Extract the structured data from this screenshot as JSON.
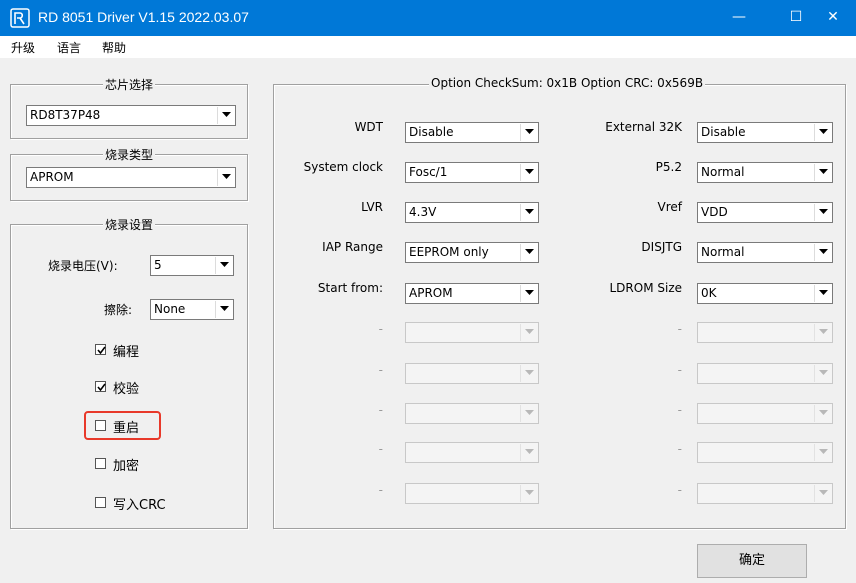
{
  "window": {
    "title": "RD 8051 Driver V1.15 2022.03.07",
    "minimize_glyph": "—",
    "maximize_glyph": "☐",
    "close_glyph": "✕"
  },
  "menu": [
    "升级",
    "语言",
    "帮助"
  ],
  "chip_select": {
    "legend": "芯片选择",
    "value": "RD8T37P48"
  },
  "burn_type": {
    "legend": "烧录类型",
    "value": "APROM"
  },
  "burn_settings": {
    "legend": "烧录设置",
    "voltage_label": "烧录电压(V):",
    "voltage_value": "5",
    "erase_label": "擦除:",
    "erase_value": "None",
    "checkboxes": [
      {
        "label": "编程",
        "checked": true
      },
      {
        "label": "校验",
        "checked": true
      },
      {
        "label": "重启",
        "checked": false
      },
      {
        "label": "加密",
        "checked": false
      },
      {
        "label": "写入CRC",
        "checked": false
      }
    ]
  },
  "options": {
    "legend": "Option CheckSum: 0x1B  Option CRC: 0x569B",
    "left": [
      {
        "label": "WDT",
        "value": "Disable"
      },
      {
        "label": "System clock",
        "value": "Fosc/1"
      },
      {
        "label": "LVR",
        "value": "4.3V"
      },
      {
        "label": "IAP Range",
        "value": "EEPROM only"
      },
      {
        "label": "Start from:",
        "value": "APROM"
      },
      {
        "label": "-",
        "value": ""
      },
      {
        "label": "-",
        "value": ""
      },
      {
        "label": "-",
        "value": ""
      },
      {
        "label": "-",
        "value": ""
      },
      {
        "label": "-",
        "value": ""
      }
    ],
    "right": [
      {
        "label": "External 32K",
        "value": "Disable"
      },
      {
        "label": "P5.2",
        "value": "Normal"
      },
      {
        "label": "Vref",
        "value": "VDD"
      },
      {
        "label": "DISJTG",
        "value": "Normal"
      },
      {
        "label": "LDROM Size",
        "value": "0K"
      },
      {
        "label": "-",
        "value": ""
      },
      {
        "label": "-",
        "value": ""
      },
      {
        "label": "-",
        "value": ""
      },
      {
        "label": "-",
        "value": ""
      },
      {
        "label": "-",
        "value": ""
      }
    ]
  },
  "ok_button": "确定",
  "accent": "#0078d7",
  "highlight_color": "#e8392a"
}
